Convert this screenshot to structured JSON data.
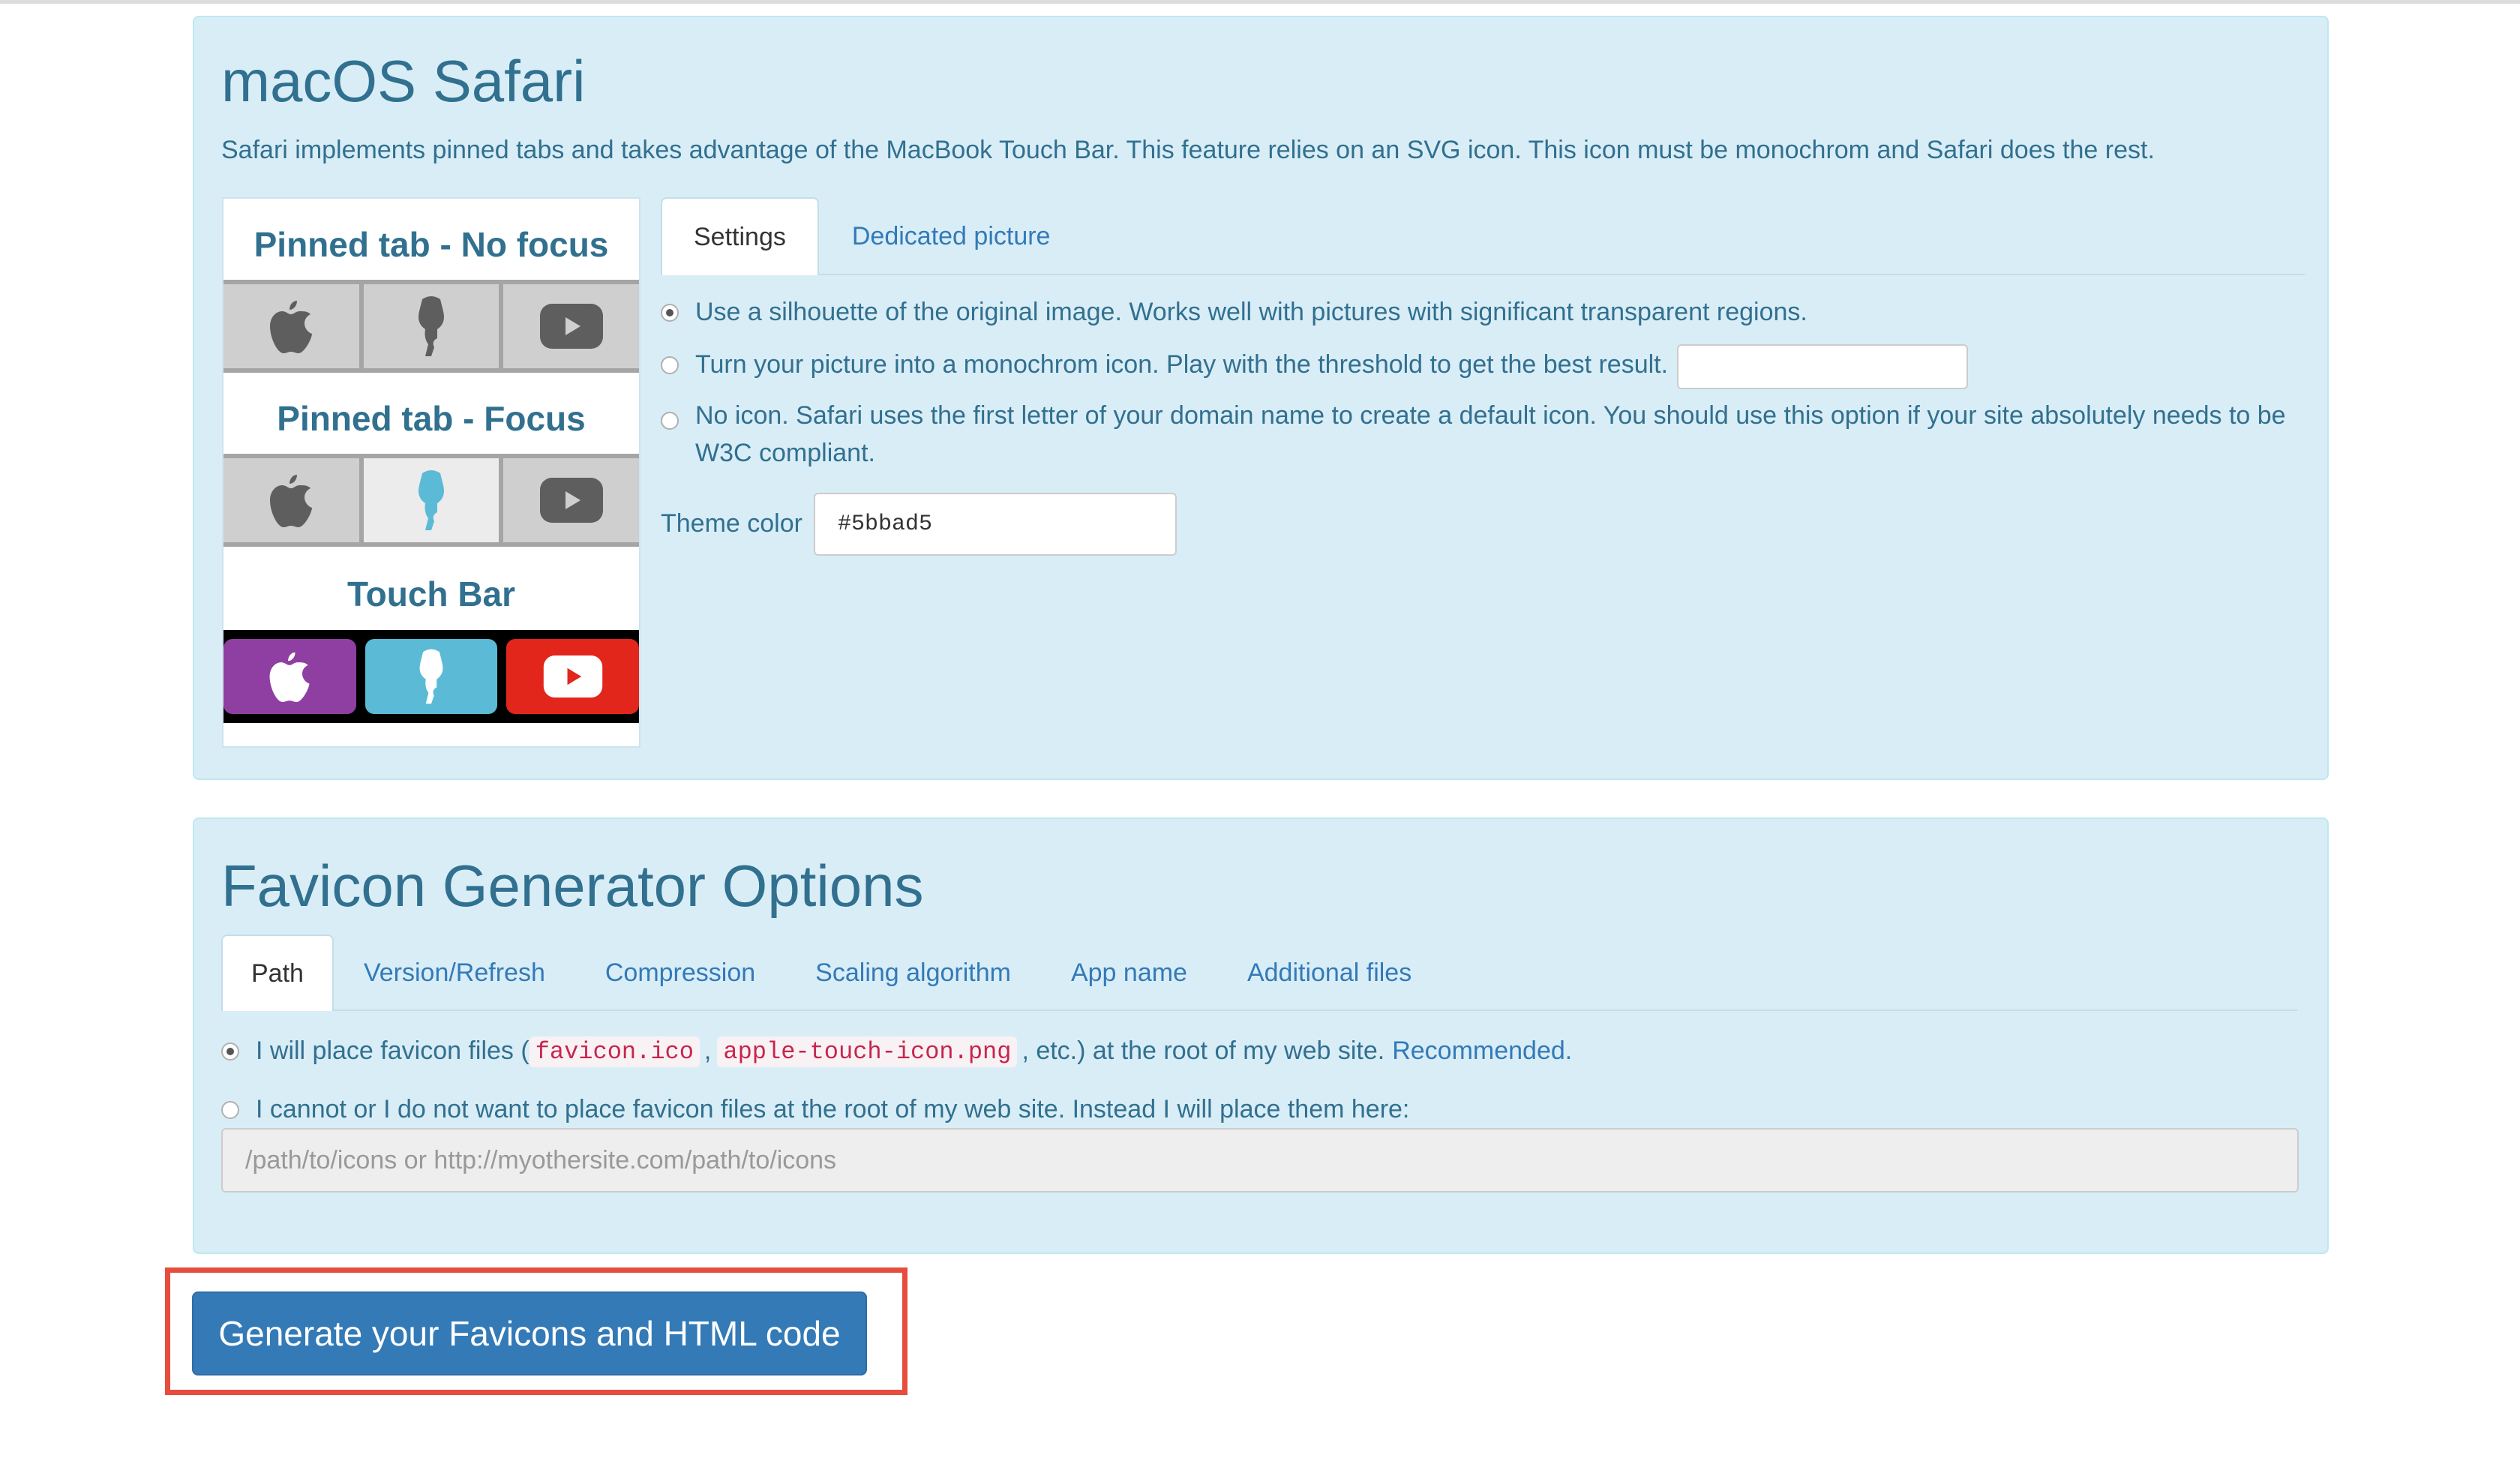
{
  "safari": {
    "title": "macOS Safari",
    "description": "Safari implements pinned tabs and takes advantage of the MacBook Touch Bar. This feature relies on an SVG icon. This icon must be monochrom and Safari does the rest.",
    "preview": {
      "no_focus_title": "Pinned tab - No focus",
      "focus_title": "Pinned tab - Focus",
      "touch_bar_title": "Touch Bar",
      "icons": [
        "apple-icon",
        "site-silhouette-icon",
        "youtube-icon"
      ],
      "colors": {
        "pinned_gray": "#5e5e5e",
        "focus_blue": "#5bbad5",
        "touch_apple_bg": "#8e3fa1",
        "touch_site_bg": "#5bbad5",
        "touch_youtube_bg": "#e2261c"
      }
    },
    "tabs": [
      {
        "label": "Settings",
        "active": true
      },
      {
        "label": "Dedicated picture",
        "active": false
      }
    ],
    "options": [
      {
        "label": "Use a silhouette of the original image. Works well with pictures with significant transparent regions.",
        "checked": true
      },
      {
        "label": "Turn your picture into a monochrom icon. Play with the threshold to get the best result.",
        "checked": false
      },
      {
        "label": "No icon. Safari uses the first letter of your domain name to create a default icon. You should use this option if your site absolutely needs to be W3C compliant.",
        "checked": false
      }
    ],
    "theme_color_label": "Theme color",
    "theme_color_value": "#5bbad5"
  },
  "options": {
    "title": "Favicon Generator Options",
    "tabs": [
      {
        "label": "Path",
        "active": true
      },
      {
        "label": "Version/Refresh",
        "active": false
      },
      {
        "label": "Compression",
        "active": false
      },
      {
        "label": "Scaling algorithm",
        "active": false
      },
      {
        "label": "App name",
        "active": false
      },
      {
        "label": "Additional files",
        "active": false
      }
    ],
    "path_option_root": {
      "prefix": "I will place favicon files (",
      "code1": "favicon.ico",
      "sep": ",",
      "code2": "apple-touch-icon.png",
      "suffix": ", etc.) at the root of my web site.",
      "recommended": "Recommended.",
      "checked": true
    },
    "path_option_custom": {
      "label": "I cannot or I do not want to place favicon files at the root of my web site. Instead I will place them here:",
      "checked": false
    },
    "path_placeholder": "/path/to/icons or http://myothersite.com/path/to/icons"
  },
  "generate_button": "Generate your Favicons and HTML code",
  "colors": {
    "panel_bg": "#d9edf7",
    "panel_text": "#31708f",
    "link": "#337ab7",
    "primary_button": "#337ab7",
    "highlight": "#e74c3c"
  }
}
